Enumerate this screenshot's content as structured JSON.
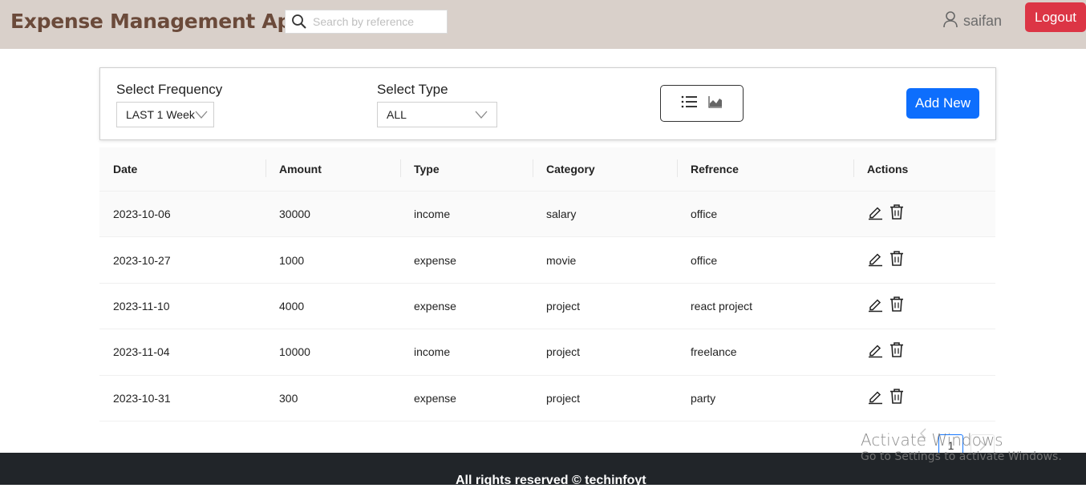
{
  "header": {
    "title": "Expense Management App",
    "search_placeholder": "Search by reference",
    "username": "saifan",
    "logout_label": "Logout"
  },
  "filters": {
    "frequency_label": "Select Frequency",
    "frequency_value": "LAST 1 Week",
    "type_label": "Select Type",
    "type_value": "ALL",
    "add_new_label": "Add New"
  },
  "table": {
    "columns": [
      "Date",
      "Amount",
      "Type",
      "Category",
      "Refrence",
      "Actions"
    ],
    "rows": [
      {
        "date": "2023-10-06",
        "amount": "30000",
        "type": "income",
        "category": "salary",
        "reference": "office"
      },
      {
        "date": "2023-10-27",
        "amount": "1000",
        "type": "expense",
        "category": "movie",
        "reference": "office"
      },
      {
        "date": "2023-11-10",
        "amount": "4000",
        "type": "expense",
        "category": "project",
        "reference": "react project"
      },
      {
        "date": "2023-11-04",
        "amount": "10000",
        "type": "income",
        "category": "project",
        "reference": "freelance"
      },
      {
        "date": "2023-10-31",
        "amount": "300",
        "type": "expense",
        "category": "project",
        "reference": "party"
      }
    ]
  },
  "pagination": {
    "current_page": "1"
  },
  "watermark": {
    "line1": "Activate Windows",
    "line2": "Go to Settings to activate Windows."
  },
  "footer": {
    "text": "All rights reserved © techinfoyt"
  },
  "colors": {
    "navbar_bg": "#d9d0ca",
    "brand": "#6b4a3a",
    "logout": "#dc3545",
    "add_new": "#0d6efd",
    "footer_bg": "#212529"
  }
}
